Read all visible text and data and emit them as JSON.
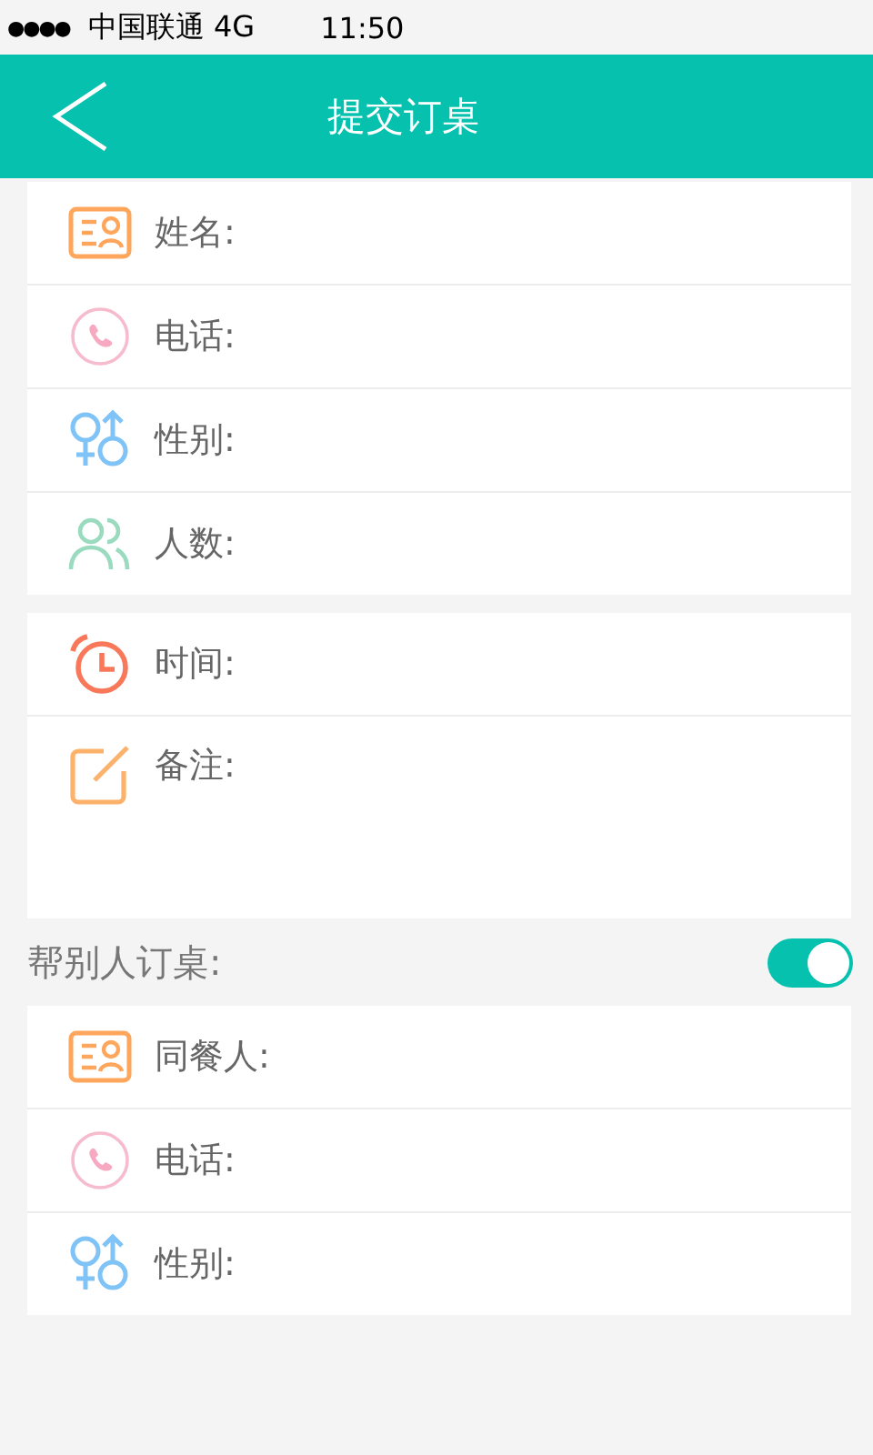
{
  "status_bar": {
    "signal": "●●●●",
    "carrier": "中国联通",
    "network": "4G",
    "time": "11:50"
  },
  "header": {
    "title": "提交订桌"
  },
  "cards": [
    {
      "rows": [
        {
          "kind": "id",
          "label": "姓名:"
        },
        {
          "kind": "phone",
          "label": "电话:"
        },
        {
          "kind": "gender",
          "label": "性别:"
        },
        {
          "kind": "people",
          "label": "人数:"
        }
      ]
    },
    {
      "rows": [
        {
          "kind": "clock",
          "label": "时间:"
        },
        {
          "kind": "note",
          "label": "备注:"
        }
      ]
    }
  ],
  "helper": {
    "label": "帮别人订桌:",
    "on": true
  },
  "helper_card": {
    "rows": [
      {
        "kind": "id",
        "label": "同餐人:"
      },
      {
        "kind": "phone",
        "label": "电话:"
      },
      {
        "kind": "gender",
        "label": "性别:"
      }
    ]
  }
}
